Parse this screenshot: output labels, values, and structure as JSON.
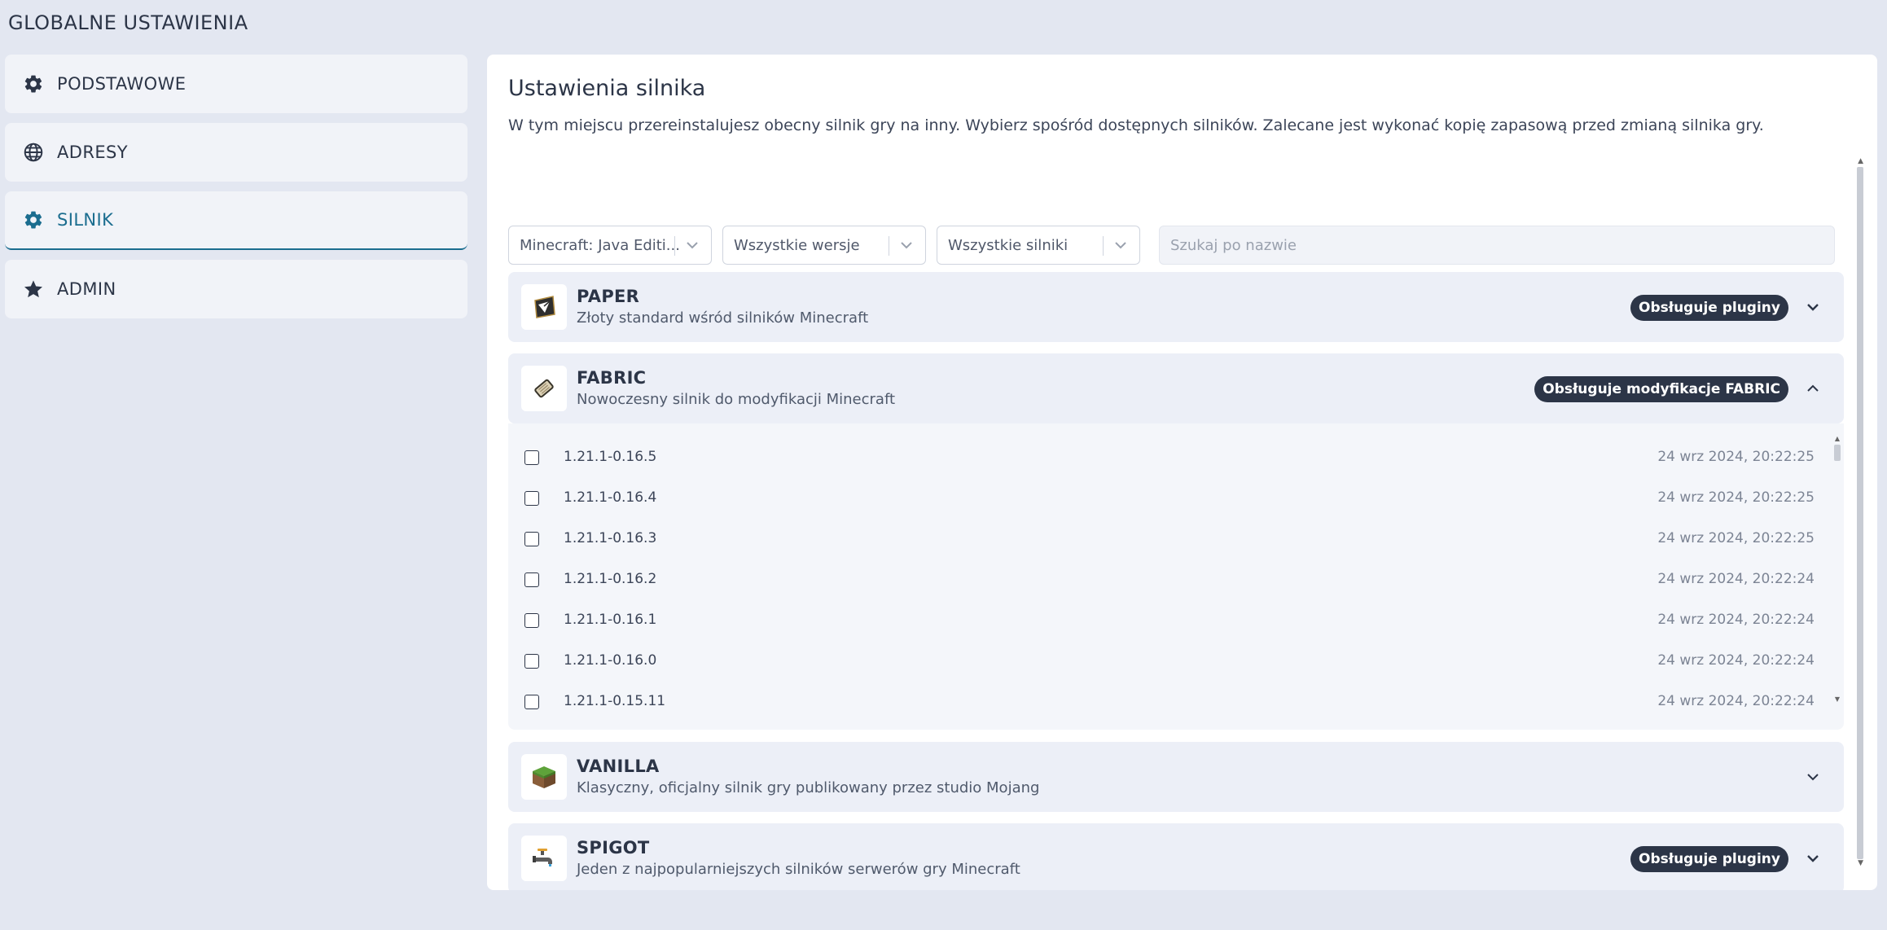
{
  "page": {
    "title": "GLOBALNE USTAWIENIA"
  },
  "sidebar": {
    "items": [
      {
        "label": "PODSTAWOWE",
        "icon": "gear-icon"
      },
      {
        "label": "ADRESY",
        "icon": "globe-icon"
      },
      {
        "label": "SILNIK",
        "icon": "gear-icon",
        "active": true
      },
      {
        "label": "ADMIN",
        "icon": "star-icon"
      }
    ]
  },
  "main": {
    "title": "Ustawienia silnika",
    "description": "W tym miejscu przereinstalujesz obecny silnik gry na inny. Wybierz spośród dostępnych silników. Zalecane jest wykonać kopię zapasową przed zmianą silnika gry.",
    "filters": {
      "game": "Minecraft: Java Editi...",
      "version": "Wszystkie wersje",
      "engine": "Wszystkie silniki",
      "search_placeholder": "Szukaj po nazwie"
    },
    "engines": [
      {
        "name": "PAPER",
        "description": "Złoty standard wśród silników Minecraft",
        "badge": "Obsługuje pluginy",
        "expanded": false
      },
      {
        "name": "FABRIC",
        "description": "Nowoczesny silnik do modyfikacji Minecraft",
        "badge": "Obsługuje modyfikacje FABRIC",
        "expanded": true
      },
      {
        "name": "VANILLA",
        "description": "Klasyczny, oficjalny silnik gry publikowany przez studio Mojang",
        "badge": "",
        "expanded": false
      },
      {
        "name": "SPIGOT",
        "description": "Jeden z najpopularniejszych silników serwerów gry Minecraft",
        "badge": "Obsługuje pluginy",
        "expanded": false
      }
    ],
    "fabric_versions": [
      {
        "version": "1.21.1-0.16.5",
        "date": "24 wrz 2024, 20:22:25"
      },
      {
        "version": "1.21.1-0.16.4",
        "date": "24 wrz 2024, 20:22:25"
      },
      {
        "version": "1.21.1-0.16.3",
        "date": "24 wrz 2024, 20:22:25"
      },
      {
        "version": "1.21.1-0.16.2",
        "date": "24 wrz 2024, 20:22:24"
      },
      {
        "version": "1.21.1-0.16.1",
        "date": "24 wrz 2024, 20:22:24"
      },
      {
        "version": "1.21.1-0.16.0",
        "date": "24 wrz 2024, 20:22:24"
      },
      {
        "version": "1.21.1-0.15.11",
        "date": "24 wrz 2024, 20:22:24"
      }
    ]
  },
  "colors": {
    "accent": "#1b6d8f",
    "badge_bg": "#2c3547",
    "page_bg": "#e3e7f1"
  }
}
